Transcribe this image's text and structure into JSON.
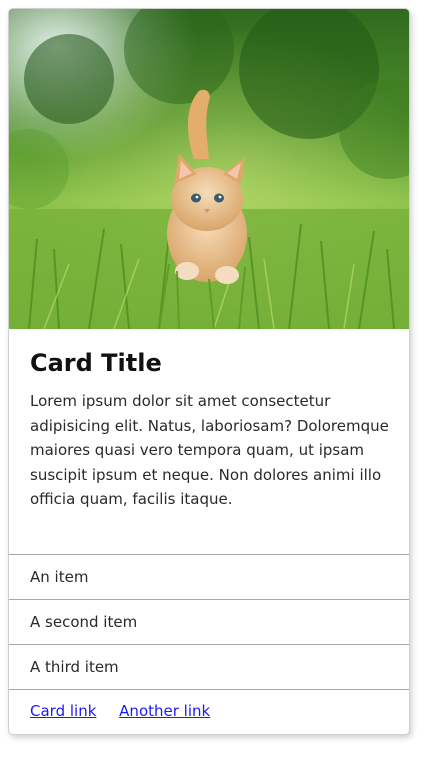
{
  "card": {
    "image_alt": "Orange kitten walking through green grass",
    "title": "Card Title",
    "text": "Lorem ipsum dolor sit amet consectetur adipisicing elit. Natus, laboriosam? Doloremque maiores quasi vero tempora quam, ut ipsam suscipit ipsum et neque. Non dolores animi illo officia quam, facilis itaque.",
    "items": [
      {
        "label": "An item"
      },
      {
        "label": "A second item"
      },
      {
        "label": "A third item"
      }
    ],
    "links": [
      {
        "label": "Card link"
      },
      {
        "label": "Another link"
      }
    ]
  },
  "colors": {
    "link": "#1a1aff",
    "border": "#a8a8a8",
    "title": "#111111"
  }
}
